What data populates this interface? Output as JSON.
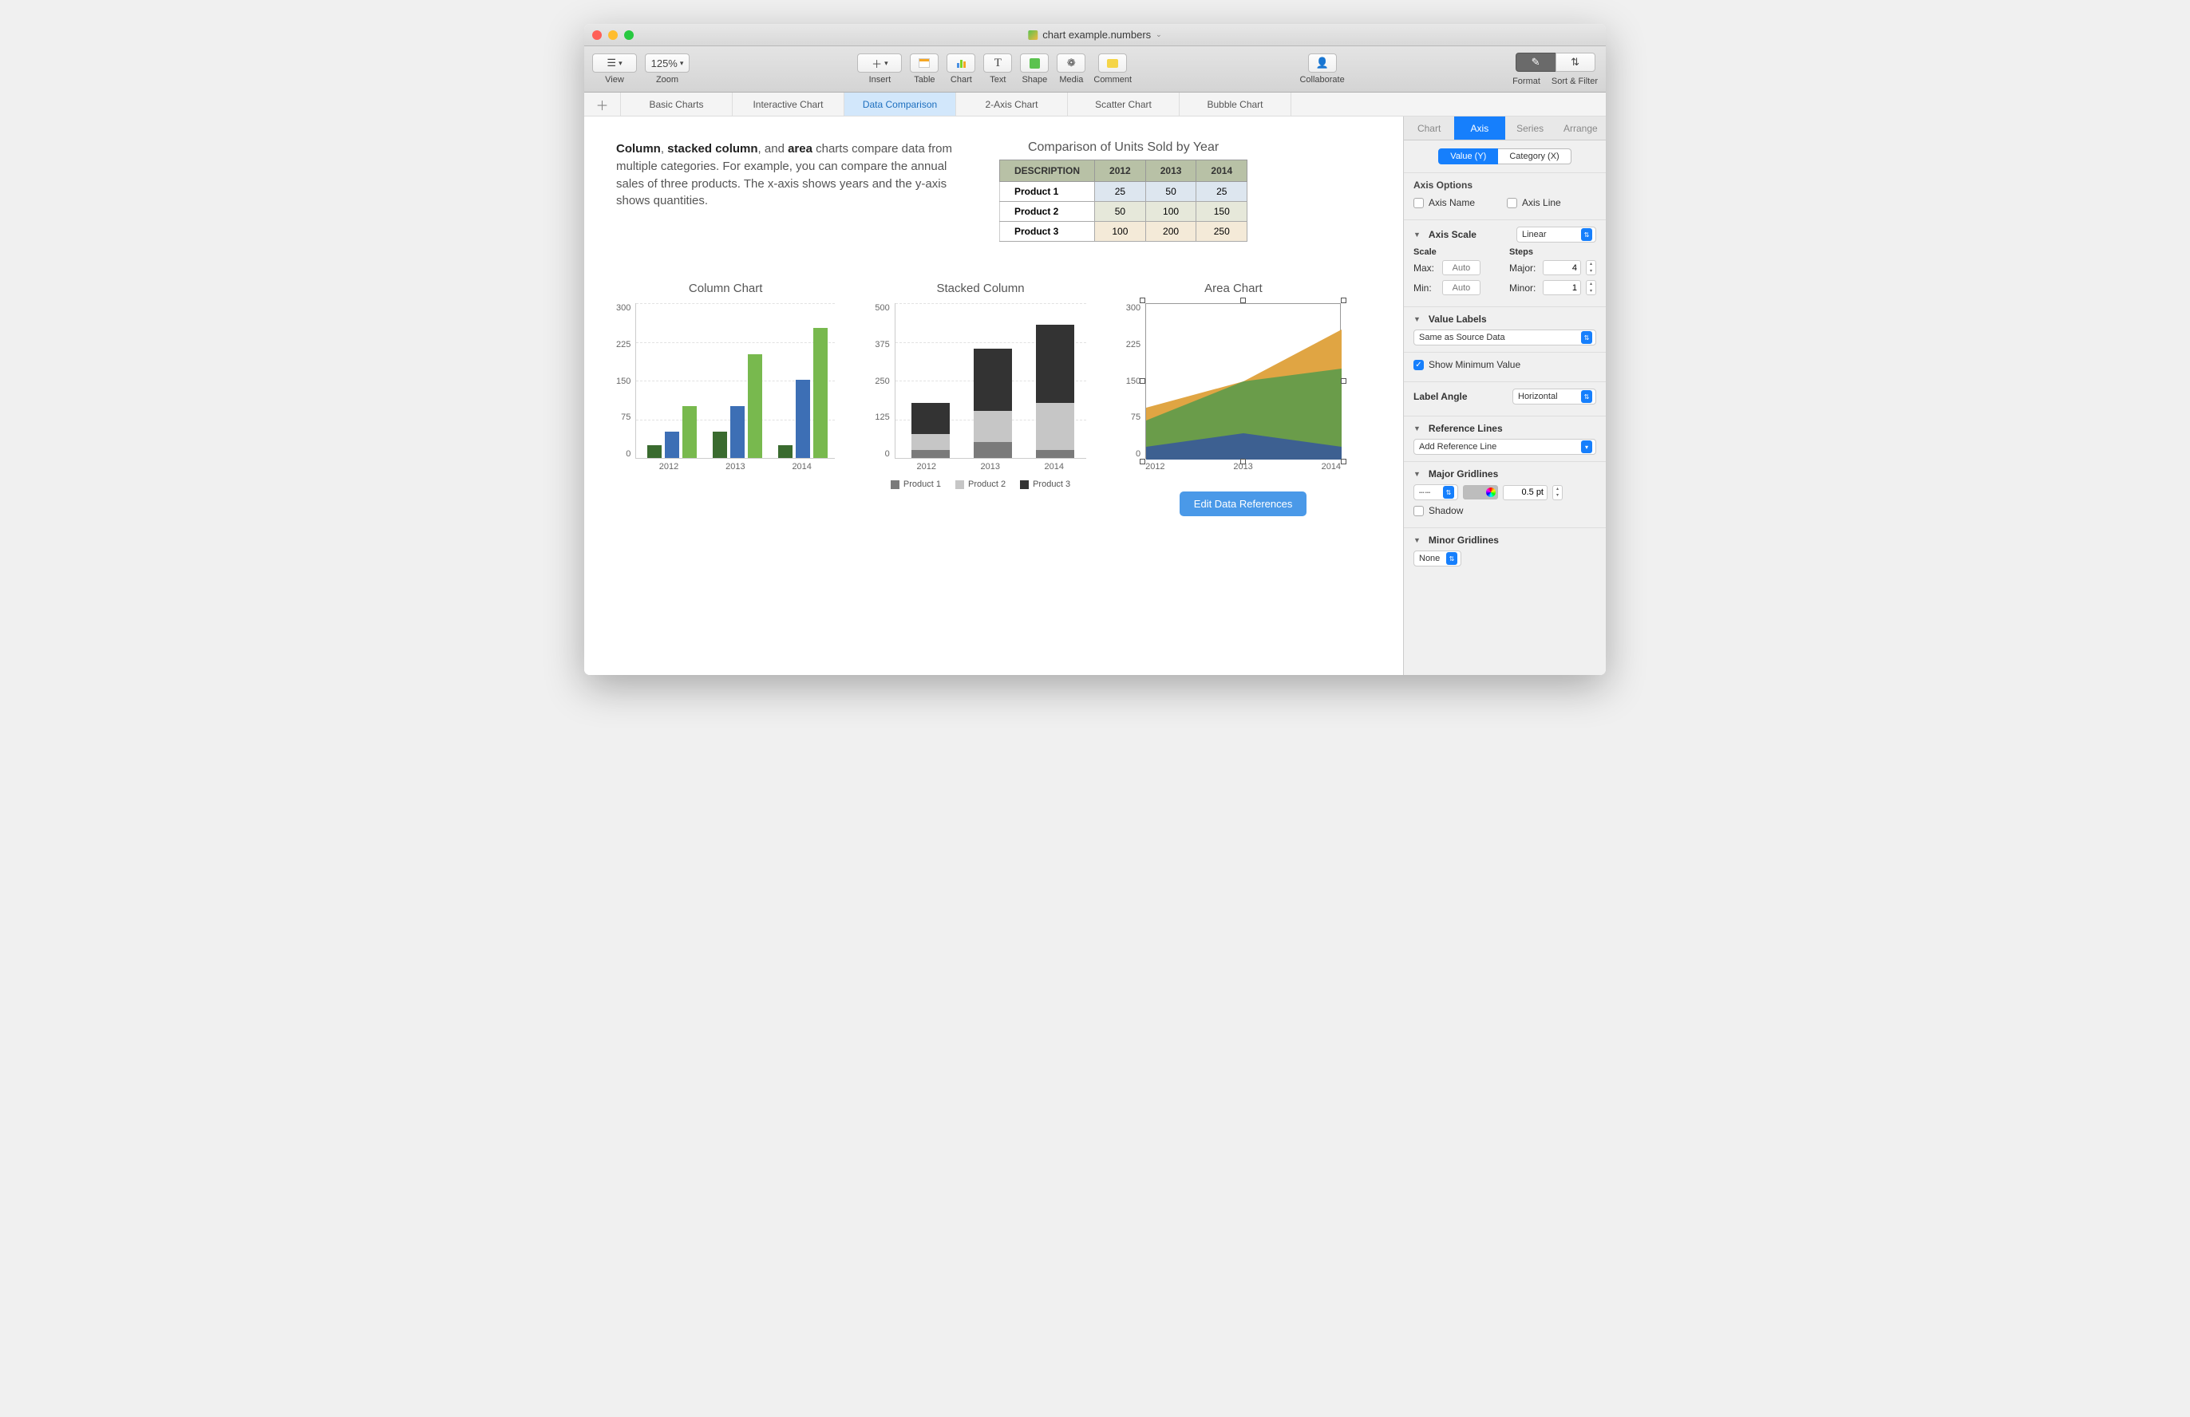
{
  "window": {
    "title": "chart example.numbers"
  },
  "toolbar": {
    "view": "View",
    "zoom": "Zoom",
    "zoom_value": "125%",
    "insert": "Insert",
    "table": "Table",
    "chart": "Chart",
    "text": "Text",
    "shape": "Shape",
    "media": "Media",
    "comment": "Comment",
    "collaborate": "Collaborate",
    "format": "Format",
    "sort": "Sort & Filter"
  },
  "tabs": {
    "items": [
      "Basic Charts",
      "Interactive Chart",
      "Data Comparison",
      "2-Axis Chart",
      "Scatter Chart",
      "Bubble Chart"
    ],
    "active": 2
  },
  "intro": {
    "b1": "Column",
    "c": ", ",
    "b2": "stacked column",
    "mid": ", and ",
    "b3": "area",
    "rest": " charts compare data from multiple categories. For example, you can compare the annual sales of three products. The x-axis shows years and the y-axis shows quantities."
  },
  "table": {
    "title": "Comparison of Units Sold by Year",
    "head": [
      "DESCRIPTION",
      "2012",
      "2013",
      "2014"
    ],
    "rows": [
      {
        "name": "Product 1",
        "cells": [
          "25",
          "50",
          "25"
        ]
      },
      {
        "name": "Product 2",
        "cells": [
          "50",
          "100",
          "150"
        ]
      },
      {
        "name": "Product 3",
        "cells": [
          "100",
          "200",
          "250"
        ]
      }
    ]
  },
  "charts": {
    "column": {
      "title": "Column Chart",
      "yticks": [
        "300",
        "225",
        "150",
        "75",
        "0"
      ],
      "x": [
        "2012",
        "2013",
        "2014"
      ]
    },
    "stacked": {
      "title": "Stacked Column",
      "yticks": [
        "500",
        "375",
        "250",
        "125",
        "0"
      ],
      "x": [
        "2012",
        "2013",
        "2014"
      ],
      "legend": [
        "Product 1",
        "Product 2",
        "Product 3"
      ]
    },
    "area": {
      "title": "Area Chart",
      "yticks": [
        "300",
        "225",
        "150",
        "75",
        "0"
      ],
      "x": [
        "2012",
        "2013",
        "2014"
      ]
    }
  },
  "edit_button": "Edit Data References",
  "inspector": {
    "tabs": [
      "Chart",
      "Axis",
      "Series",
      "Arrange"
    ],
    "active": 1,
    "axis_seg": [
      "Value (Y)",
      "Category (X)"
    ],
    "axis_seg_active": 0,
    "axis_options": "Axis Options",
    "axis_name": "Axis Name",
    "axis_line": "Axis Line",
    "axis_scale": "Axis Scale",
    "linear": "Linear",
    "scale": "Scale",
    "steps": "Steps",
    "max": "Max:",
    "min": "Min:",
    "auto": "Auto",
    "major": "Major:",
    "minor": "Minor:",
    "major_v": "4",
    "minor_v": "1",
    "value_labels": "Value Labels",
    "same_as": "Same as Source Data",
    "show_min": "Show Minimum Value",
    "label_angle": "Label Angle",
    "horizontal": "Horizontal",
    "ref_lines": "Reference Lines",
    "add_ref": "Add Reference Line",
    "major_grid": "Major Gridlines",
    "pt": "0.5 pt",
    "shadow": "Shadow",
    "minor_grid": "Minor Gridlines",
    "none": "None"
  },
  "chart_data": [
    {
      "type": "table",
      "title": "Comparison of Units Sold by Year",
      "columns": [
        "DESCRIPTION",
        "2012",
        "2013",
        "2014"
      ],
      "rows": [
        [
          "Product 1",
          25,
          50,
          25
        ],
        [
          "Product 2",
          50,
          100,
          150
        ],
        [
          "Product 3",
          100,
          200,
          250
        ]
      ]
    },
    {
      "type": "bar",
      "title": "Column Chart",
      "categories": [
        "2012",
        "2013",
        "2014"
      ],
      "series": [
        {
          "name": "Product 1",
          "values": [
            25,
            50,
            25
          ]
        },
        {
          "name": "Product 2",
          "values": [
            50,
            100,
            150
          ]
        },
        {
          "name": "Product 3",
          "values": [
            100,
            200,
            250
          ]
        }
      ],
      "ylabel": "",
      "ylim": [
        0,
        300
      ]
    },
    {
      "type": "bar",
      "stacked": true,
      "title": "Stacked Column",
      "categories": [
        "2012",
        "2013",
        "2014"
      ],
      "series": [
        {
          "name": "Product 1",
          "values": [
            25,
            50,
            25
          ]
        },
        {
          "name": "Product 2",
          "values": [
            50,
            100,
            150
          ]
        },
        {
          "name": "Product 3",
          "values": [
            100,
            200,
            250
          ]
        }
      ],
      "ylabel": "",
      "ylim": [
        0,
        500
      ]
    },
    {
      "type": "area",
      "title": "Area Chart",
      "x": [
        "2012",
        "2013",
        "2014"
      ],
      "series": [
        {
          "name": "Product 1",
          "values": [
            25,
            50,
            25
          ]
        },
        {
          "name": "Product 2",
          "values": [
            50,
            100,
            150
          ]
        },
        {
          "name": "Product 3",
          "values": [
            100,
            200,
            250
          ]
        }
      ],
      "ylabel": "",
      "ylim": [
        0,
        300
      ]
    }
  ]
}
